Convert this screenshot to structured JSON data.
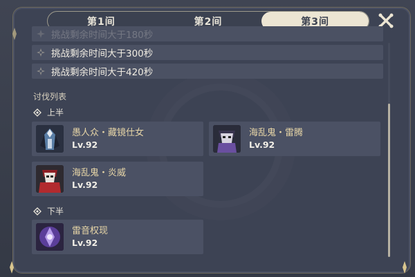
{
  "tabs": [
    {
      "label": "第1间",
      "active": false
    },
    {
      "label": "第2间",
      "active": false
    },
    {
      "label": "第3间",
      "active": true
    }
  ],
  "challenges": [
    {
      "text": "挑战剩余时间大于180秒",
      "faded": true
    },
    {
      "text": "挑战剩余时间大于300秒",
      "faded": false
    },
    {
      "text": "挑战剩余时间大于420秒",
      "faded": false
    }
  ],
  "enemy_list": {
    "title": "讨伐列表",
    "first_half": {
      "label": "上半",
      "enemies": [
        {
          "name": "愚人众・藏镜仕女",
          "level": "Lv.92"
        },
        {
          "name": "海乱鬼・雷腾",
          "level": "Lv.92"
        },
        {
          "name": "海乱鬼・炎威",
          "level": "Lv.92"
        }
      ]
    },
    "second_half": {
      "label": "下半",
      "enemies": [
        {
          "name": "雷音权现",
          "level": "Lv.92"
        }
      ]
    }
  },
  "icons": {
    "close": "close-icon",
    "challenge": "star-badge-icon",
    "group": "diamond-icon"
  },
  "colors": {
    "panel": "#3d4354",
    "row": "#4b5163",
    "enemy_name": "#e8d6a7",
    "tab_active": "#ece5d3"
  }
}
